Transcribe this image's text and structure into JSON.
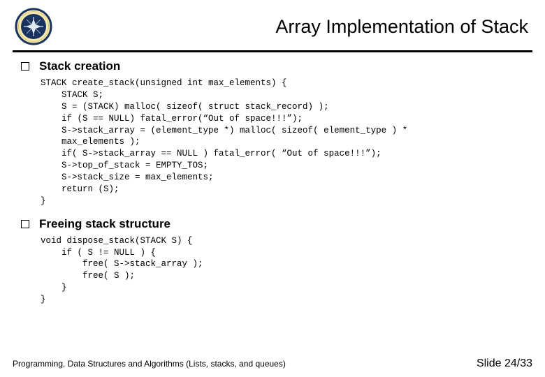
{
  "header": {
    "title": "Array Implementation of Stack"
  },
  "sections": [
    {
      "title": "Stack creation",
      "code": "STACK create_stack(unsigned int max_elements) {\n    STACK S;\n    S = (STACK) malloc( sizeof( struct stack_record) );\n    if (S == NULL) fatal_error(“Out of space!!!”);\n    S->stack_array = (element_type *) malloc( sizeof( element_type ) *\n    max_elements );\n    if( S->stack_array == NULL ) fatal_error( “Out of space!!!”);\n    S->top_of_stack = EMPTY_TOS;\n    S->stack_size = max_elements;\n    return (S);\n}"
    },
    {
      "title": "Freeing stack structure",
      "code": "void dispose_stack(STACK S) {\n    if ( S != NULL ) {\n        free( S->stack_array );\n        free( S );\n    }\n}"
    }
  ],
  "footer": {
    "left": "Programming, Data Structures and Algorithms  (Lists, stacks, and queues)",
    "right": "Slide 24/33"
  },
  "icons": {
    "logo": "seal-logo"
  }
}
